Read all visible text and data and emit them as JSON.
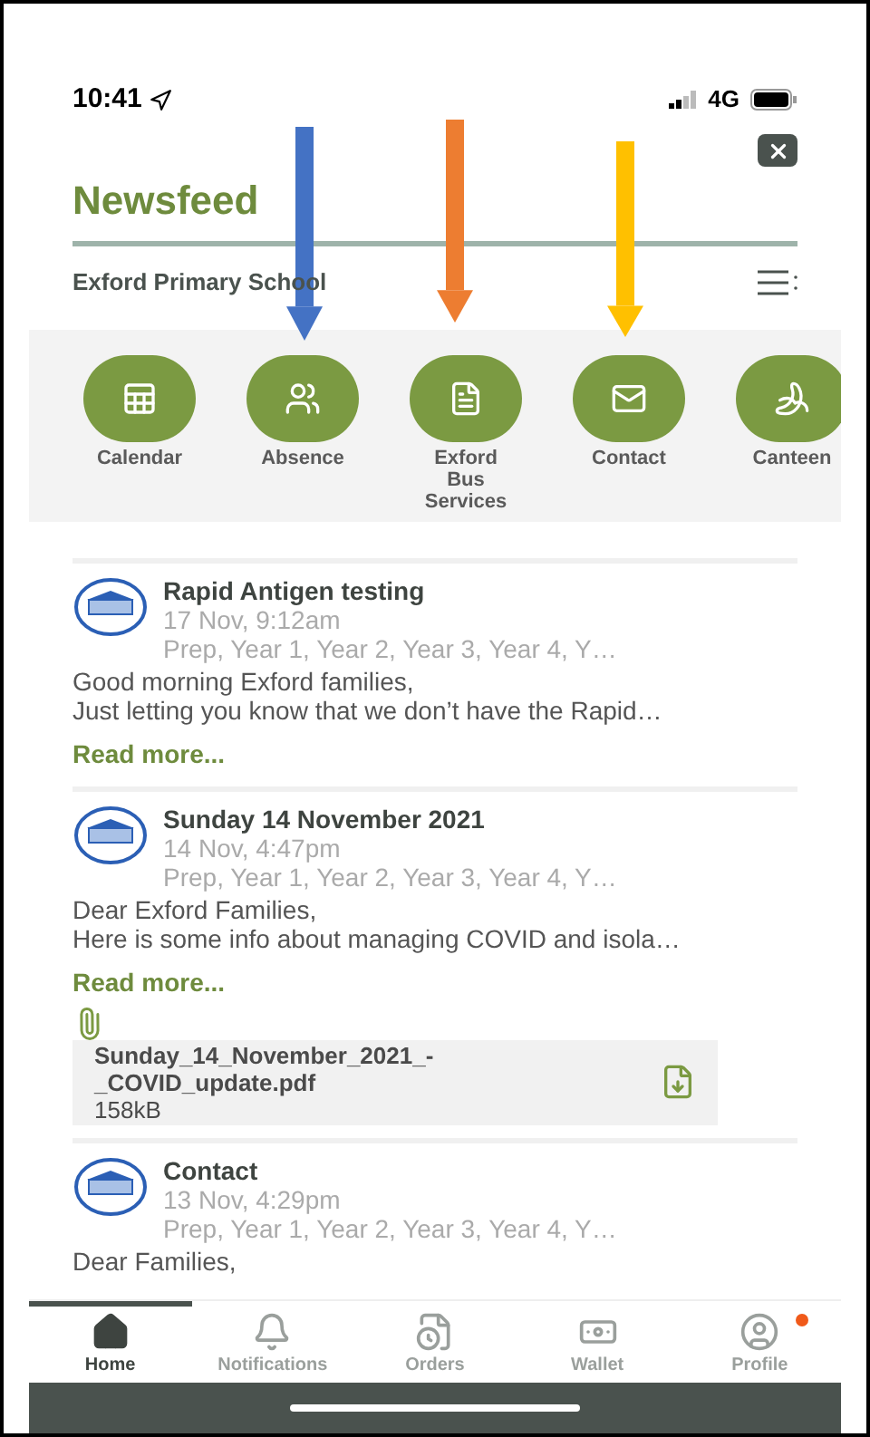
{
  "status_bar": {
    "time": "10:41",
    "network": "4G"
  },
  "header": {
    "title": "Newsfeed",
    "school": "Exford Primary School"
  },
  "shortcuts": [
    {
      "kind": "calendar",
      "label": "Calendar"
    },
    {
      "kind": "absence",
      "label": "Absence"
    },
    {
      "kind": "document",
      "label": "Exford Bus Services"
    },
    {
      "kind": "mail",
      "label": "Contact"
    },
    {
      "kind": "canteen",
      "label": "Canteen"
    }
  ],
  "annotations": [
    {
      "color": "#4472c4"
    },
    {
      "color": "#ed7d31"
    },
    {
      "color": "#ffc000"
    }
  ],
  "posts": [
    {
      "title": "Rapid Antigen testing",
      "date": "17 Nov, 9:12am",
      "audience": "Prep, Year 1, Year 2, Year 3, Year 4, Y…",
      "body": [
        "Good morning Exford families,",
        "Just letting you know that we don’t have the Rapid…"
      ],
      "read_more": "Read more..."
    },
    {
      "title": "Sunday 14 November 2021",
      "date": "14 Nov, 4:47pm",
      "audience": "Prep, Year 1, Year 2, Year 3, Year 4, Y…",
      "body": [
        "Dear Exford Families,",
        "Here is some info about managing COVID and isola…"
      ],
      "read_more": "Read more...",
      "attachment": {
        "name": [
          "Sunday_14_November_2021_-",
          "_COVID_update.pdf"
        ],
        "size": "158kB"
      }
    },
    {
      "title": "Contact",
      "date": "13 Nov, 4:29pm",
      "audience": "Prep, Year 1, Year 2, Year 3, Year 4, Y…",
      "body": [
        "Dear Families,"
      ]
    }
  ],
  "nav": [
    {
      "kind": "home",
      "label": "Home",
      "selected": true
    },
    {
      "kind": "bell",
      "label": "Notifications",
      "selected": false
    },
    {
      "kind": "orders",
      "label": "Orders",
      "selected": false
    },
    {
      "kind": "wallet",
      "label": "Wallet",
      "selected": false
    },
    {
      "kind": "profile",
      "label": "Profile",
      "selected": false,
      "badge": true
    }
  ]
}
